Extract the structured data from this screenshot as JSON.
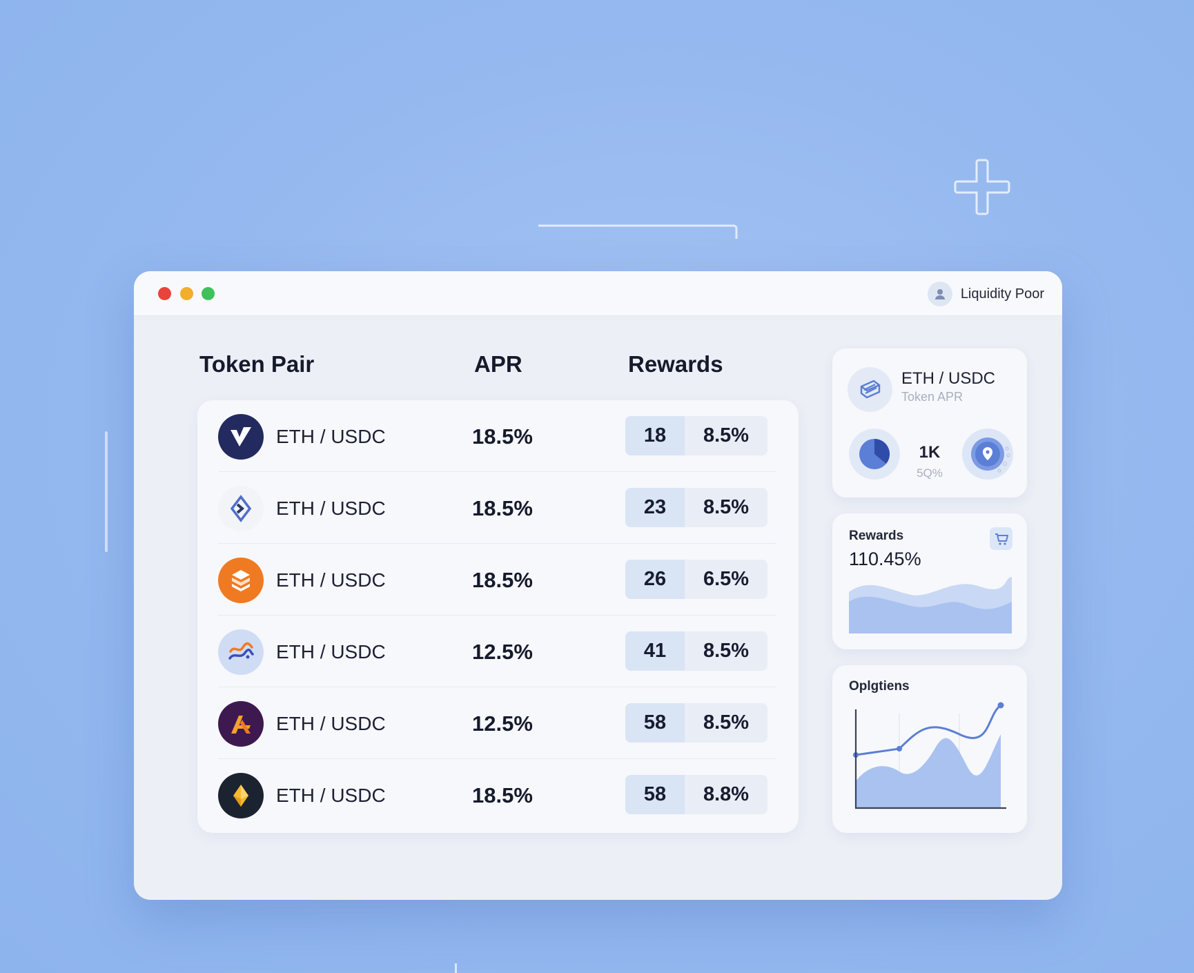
{
  "window": {
    "account_label": "Liquidity Poor"
  },
  "table": {
    "headers": [
      "Token Pair",
      "APR",
      "Rewards"
    ],
    "rows": [
      {
        "pair": "ETH / USDC",
        "apr": "18.5%",
        "reward_count": "18",
        "reward_rate": "8.5%",
        "icon": "v-logo-icon"
      },
      {
        "pair": "ETH / USDC",
        "apr": "18.5%",
        "reward_count": "23",
        "reward_rate": "8.5%",
        "icon": "diamond-arrow-icon"
      },
      {
        "pair": "ETH / USDC",
        "apr": "18.5%",
        "reward_count": "26",
        "reward_rate": "6.5%",
        "icon": "cube-stack-icon"
      },
      {
        "pair": "ETH / USDC",
        "apr": "12.5%",
        "reward_count": "41",
        "reward_rate": "8.5%",
        "icon": "swirl-icon"
      },
      {
        "pair": "ETH / USDC",
        "apr": "12.5%",
        "reward_count": "58",
        "reward_rate": "8.5%",
        "icon": "ax-logo-icon"
      },
      {
        "pair": "ETH / USDC",
        "apr": "18.5%",
        "reward_count": "58",
        "reward_rate": "8.8%",
        "icon": "eth-diamond-icon"
      }
    ]
  },
  "pair_card": {
    "title": "ETH / USDC",
    "subtitle": "Token APR",
    "stat_value": "1K",
    "stat_sub": "5Q%"
  },
  "rewards_card": {
    "label": "Rewards",
    "value": "110.45%"
  },
  "chart_card": {
    "title": "Oplgtiens"
  },
  "colors": {
    "background": "#94b8ef",
    "window": "#eceff6",
    "card": "#f7f8fb",
    "accent": "#5b7fd6",
    "fill": "#a9c2f0"
  }
}
